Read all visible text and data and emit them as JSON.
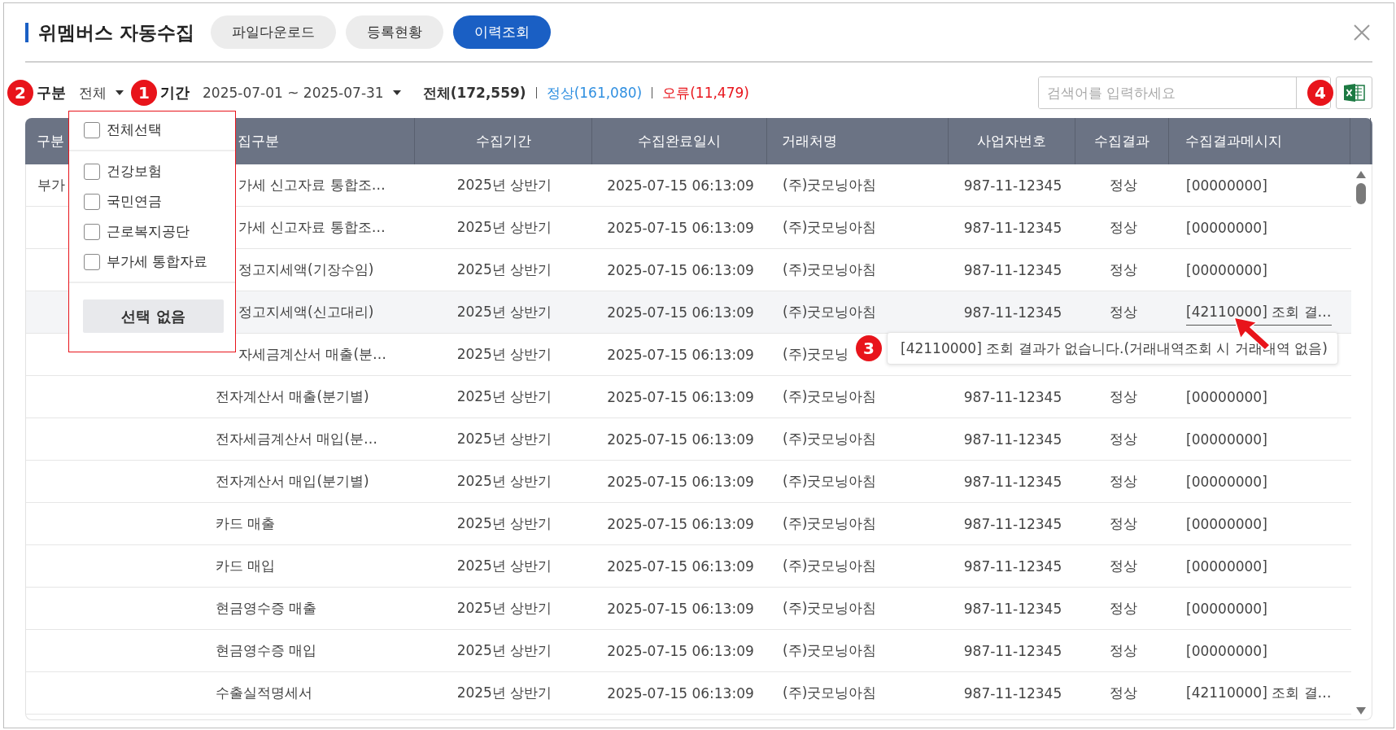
{
  "title": "위멤버스 자동수집",
  "tabs": [
    {
      "label": "파일다운로드",
      "selected": false
    },
    {
      "label": "등록현황",
      "selected": false
    },
    {
      "label": "이력조회",
      "selected": true
    }
  ],
  "filters": {
    "category_callout": "2",
    "category_label": "구분",
    "category_value": "전체",
    "period_callout": "1",
    "period_label": "기간",
    "period_value": "2025-07-01 ~ 2025-07-31"
  },
  "summary": [
    {
      "kind": "total",
      "text": "전체(172,559)",
      "color": "#333333"
    },
    {
      "kind": "normal",
      "text": "정상(161,080)",
      "color": "#2f8fe0"
    },
    {
      "kind": "error",
      "text": "오류(11,479)",
      "color": "#e8141b"
    }
  ],
  "search": {
    "placeholder": "검색어를 입력하세요",
    "callout": "4"
  },
  "category_dropdown": {
    "open": true,
    "select_all": {
      "label": "전체선택",
      "checked": false
    },
    "options": [
      {
        "label": "건강보험",
        "checked": false
      },
      {
        "label": "국민연금",
        "checked": false
      },
      {
        "label": "근로복지공단",
        "checked": false
      },
      {
        "label": "부가세 통합자료",
        "checked": false
      }
    ],
    "clear_button": "선택 없음"
  },
  "table": {
    "columns": [
      "구분",
      "집구분",
      "수집기간",
      "수집완료일시",
      "거래처명",
      "사업자번호",
      "수집결과",
      "수집결과메시지"
    ],
    "rows": [
      {
        "category": "부가",
        "type": "가세 신고자료 통합조…",
        "period": "2025년 상반기",
        "completed": "2025-07-15 06:13:09",
        "client": "(주)굿모닝아침",
        "biz_no": "987-11-12345",
        "result": "정상",
        "message": "[00000000]",
        "highlighted": false
      },
      {
        "type": "가세 신고자료 통합조…",
        "period": "2025년 상반기",
        "completed": "2025-07-15 06:13:09",
        "client": "(주)굿모닝아침",
        "biz_no": "987-11-12345",
        "result": "정상",
        "message": "[00000000]",
        "highlighted": false
      },
      {
        "type": "정고지세액(기장수임)",
        "period": "2025년 상반기",
        "completed": "2025-07-15 06:13:09",
        "client": "(주)굿모닝아침",
        "biz_no": "987-11-12345",
        "result": "정상",
        "message": "[00000000]",
        "highlighted": false
      },
      {
        "type": "정고지세액(신고대리)",
        "period": "2025년 상반기",
        "completed": "2025-07-15 06:13:09",
        "client": "(주)굿모닝아침",
        "biz_no": "987-11-12345",
        "result": "정상",
        "message": "[42110000] 조회 결…",
        "highlighted": true
      },
      {
        "type": "자세금계산서 매출(분…",
        "period": "2025년 상반기",
        "completed": "2025-07-15 06:13:09",
        "client": "(주)굿모닝",
        "highlighted": false
      },
      {
        "type": "전자계산서 매출(분기별)",
        "period": "2025년 상반기",
        "completed": "2025-07-15 06:13:09",
        "client": "(주)굿모닝아침",
        "biz_no": "987-11-12345",
        "result": "정상",
        "message": "[00000000]",
        "highlighted": false
      },
      {
        "type": "전자세금계산서 매입(분…",
        "period": "2025년 상반기",
        "completed": "2025-07-15 06:13:09",
        "client": "(주)굿모닝아침",
        "biz_no": "987-11-12345",
        "result": "정상",
        "message": "[00000000]",
        "highlighted": false
      },
      {
        "type": "전자계산서 매입(분기별)",
        "period": "2025년 상반기",
        "completed": "2025-07-15 06:13:09",
        "client": "(주)굿모닝아침",
        "biz_no": "987-11-12345",
        "result": "정상",
        "message": "[00000000]",
        "highlighted": false
      },
      {
        "type": "카드 매출",
        "period": "2025년 상반기",
        "completed": "2025-07-15 06:13:09",
        "client": "(주)굿모닝아침",
        "biz_no": "987-11-12345",
        "result": "정상",
        "message": "[00000000]",
        "highlighted": false
      },
      {
        "type": "카드 매입",
        "period": "2025년 상반기",
        "completed": "2025-07-15 06:13:09",
        "client": "(주)굿모닝아침",
        "biz_no": "987-11-12345",
        "result": "정상",
        "message": "[00000000]",
        "highlighted": false
      },
      {
        "type": "현금영수증 매출",
        "period": "2025년 상반기",
        "completed": "2025-07-15 06:13:09",
        "client": "(주)굿모닝아침",
        "biz_no": "987-11-12345",
        "result": "정상",
        "message": "[00000000]",
        "highlighted": false
      },
      {
        "type": "현금영수증 매입",
        "period": "2025년 상반기",
        "completed": "2025-07-15 06:13:09",
        "client": "(주)굿모닝아침",
        "biz_no": "987-11-12345",
        "result": "정상",
        "message": "[00000000]",
        "highlighted": false
      },
      {
        "type": "수출실적명세서",
        "period": "2025년 상반기",
        "completed": "2025-07-15 06:13:09",
        "client": "(주)굿모닝아침",
        "biz_no": "987-11-12345",
        "result": "정상",
        "message": "[42110000] 조회 결…",
        "highlighted": false
      }
    ]
  },
  "tooltip": {
    "callout": "3",
    "text": "[42110000] 조회 결과가 없습니다.(거래내역조회 시 거래내역 없음)"
  }
}
